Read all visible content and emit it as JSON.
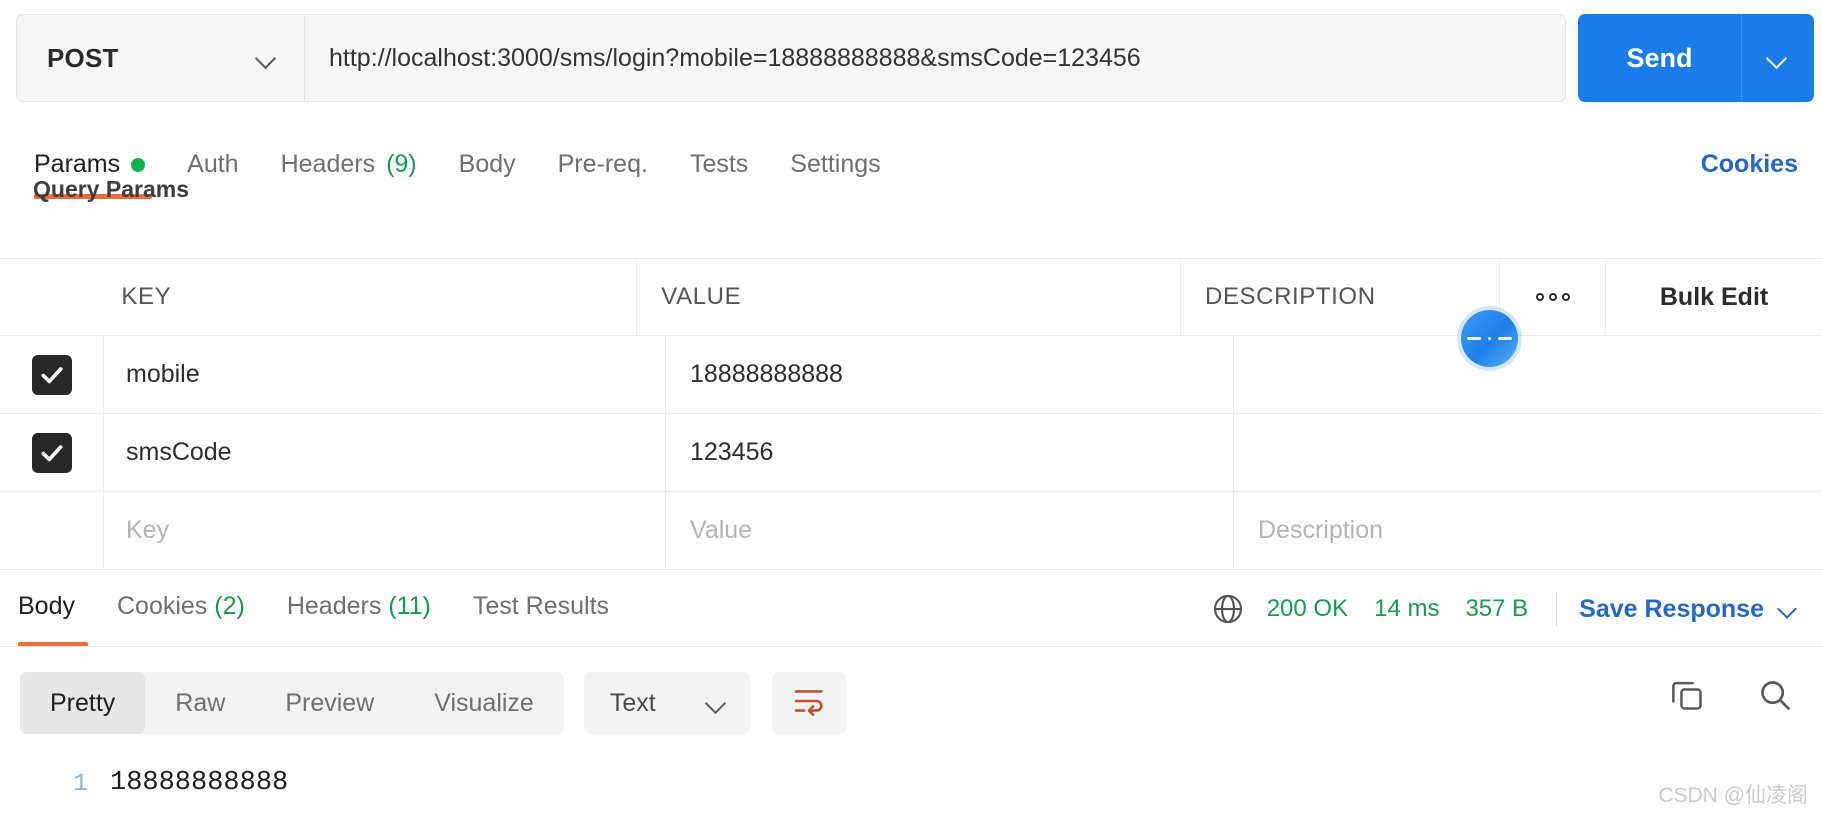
{
  "request": {
    "method": "POST",
    "method_caret_icon": "chevron-down-icon",
    "url": "http://localhost:3000/sms/login?mobile=18888888888&smsCode=123456",
    "send_label": "Send",
    "send_caret_icon": "chevron-down-icon"
  },
  "request_tabs": [
    {
      "label": "Params",
      "badge": "",
      "dot": true,
      "active": true
    },
    {
      "label": "Auth",
      "badge": "",
      "dot": false,
      "active": false
    },
    {
      "label": "Headers",
      "badge": "(9)",
      "dot": false,
      "active": false
    },
    {
      "label": "Body",
      "badge": "",
      "dot": false,
      "active": false
    },
    {
      "label": "Pre-req.",
      "badge": "",
      "dot": false,
      "active": false
    },
    {
      "label": "Tests",
      "badge": "",
      "dot": false,
      "active": false
    },
    {
      "label": "Settings",
      "badge": "",
      "dot": false,
      "active": false
    }
  ],
  "cookies_link": "Cookies",
  "params": {
    "section_title": "Query Params",
    "columns": [
      "KEY",
      "VALUE",
      "DESCRIPTION"
    ],
    "more_icon": "ooo",
    "bulk_edit_label": "Bulk Edit",
    "rows": [
      {
        "checked": true,
        "key": "mobile",
        "value": "18888888888",
        "description": ""
      },
      {
        "checked": true,
        "key": "smsCode",
        "value": "123456",
        "description": ""
      }
    ],
    "placeholder_row": {
      "key": "Key",
      "value": "Value",
      "description": "Description"
    }
  },
  "response_tabs": [
    {
      "label": "Body",
      "badge": "",
      "active": true
    },
    {
      "label": "Cookies",
      "badge": "(2)",
      "active": false
    },
    {
      "label": "Headers",
      "badge": "(11)",
      "active": false
    },
    {
      "label": "Test Results",
      "badge": "",
      "active": false
    }
  ],
  "response_status": {
    "globe_icon": "globe-icon",
    "status": "200 OK",
    "time": "14 ms",
    "size": "357 B",
    "save_label": "Save Response",
    "save_caret_icon": "chevron-down-icon"
  },
  "format_bar": {
    "modes": [
      "Pretty",
      "Raw",
      "Preview",
      "Visualize"
    ],
    "active_mode": "Pretty",
    "language": "Text",
    "language_caret_icon": "chevron-down-icon",
    "wrap_icon": "wrap-text-icon",
    "copy_icon": "copy-icon",
    "search_icon": "search-icon"
  },
  "response_body": {
    "lines": [
      {
        "number": "1",
        "text": "18888888888"
      }
    ]
  },
  "watermark": "CSDN @仙凌阁",
  "colors": {
    "accent_blue": "#1a7ce8",
    "link_blue": "#2668c9",
    "underline_orange": "#f26b3a",
    "status_green": "#1a9b4b"
  }
}
